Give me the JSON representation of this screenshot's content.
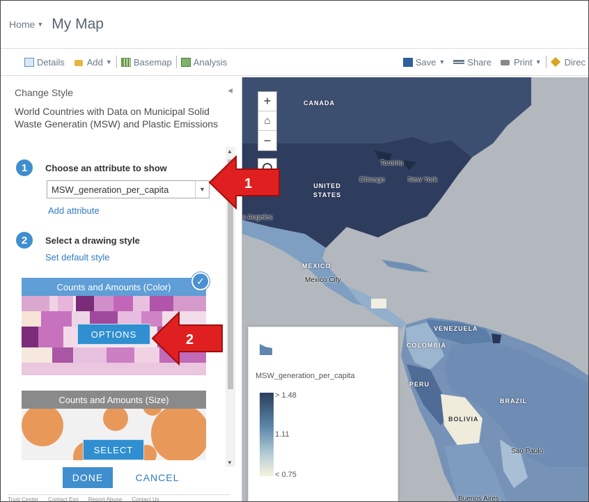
{
  "header": {
    "home_label": "Home",
    "map_title": "My Map"
  },
  "toolbar": {
    "details": "Details",
    "add": "Add",
    "basemap": "Basemap",
    "analysis": "Analysis",
    "save": "Save",
    "share": "Share",
    "print": "Print",
    "directions": "Direc"
  },
  "panel": {
    "title": "Change Style",
    "layer_name": "World Countries with Data on Municipal Solid Waste Generatin (MSW) and Plastic Emissions",
    "step1": {
      "number": "1",
      "label": "Choose an attribute to show"
    },
    "attribute_value": "MSW_generation_per_capita",
    "add_attribute": "Add attribute",
    "step2": {
      "number": "2",
      "label": "Select a drawing style"
    },
    "set_default": "Set default style",
    "card1": {
      "title": "Counts and Amounts (Color)",
      "button": "OPTIONS",
      "selected": true
    },
    "card2": {
      "title": "Counts and Amounts (Size)",
      "button": "SELECT"
    },
    "done": "DONE",
    "cancel": "CANCEL",
    "footer": [
      "Trust Center",
      "Contact Esri",
      "Report Abuse",
      "Contact Us"
    ]
  },
  "callouts": {
    "arrow1": "1",
    "arrow2": "2"
  },
  "map": {
    "labels": {
      "canada": "CANADA",
      "us": "UNITED STATES",
      "mexico": "MEXICO",
      "venezuela": "VENEZUELA",
      "colombia": "COLOMBIA",
      "peru": "PERU",
      "brazil": "BRAZIL",
      "bolivia": "BOLIVIA"
    },
    "cities": {
      "toronto": "Toronto",
      "chicago": "Chicago",
      "new_york": "New York",
      "los_angeles": "s Angeles",
      "mexico_city": "Mexico City",
      "sao_paulo": "Sao Paulo",
      "buenos_aires": "Buenos Aires"
    },
    "zoom_in": "+",
    "zoom_out": "−",
    "legend": {
      "field": "MSW_generation_per_capita",
      "high": "> 1.48",
      "mid": "1.11",
      "low": "< 0.75"
    }
  },
  "colors": {
    "accent": "#3f8ece",
    "arrow": "#e02020",
    "dark_country": "#2f3f5f"
  }
}
